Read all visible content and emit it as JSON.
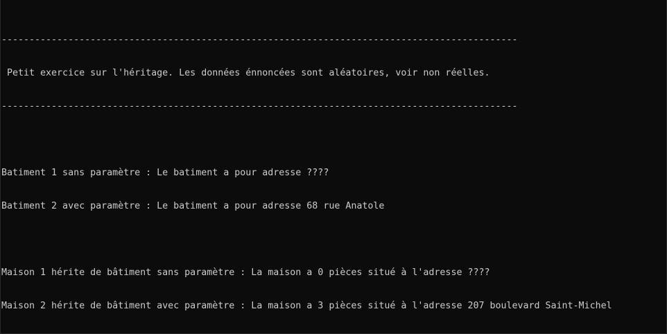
{
  "console": {
    "lines": [
      "---------------------------------------------------------------------------------------------",
      " Petit exercice sur l'héritage. Les données énnoncées sont aléatoires, voir non réelles.",
      "---------------------------------------------------------------------------------------------",
      "",
      "Batiment 1 sans paramètre : Le batiment a pour adresse ????",
      "Batiment 2 avec paramètre : Le batiment a pour adresse 68 rue Anatole",
      "",
      "Maison 1 hérite de bâtiment sans paramètre : La maison a 0 pièces situé à l'adresse ????",
      "Maison 2 hérite de bâtiment avec paramètre : La maison a 3 pièces situé à l'adresse 207 boulevard Saint-Michel"
    ]
  },
  "colors": {
    "background": "#0c0c0c",
    "text": "#cccccc"
  }
}
